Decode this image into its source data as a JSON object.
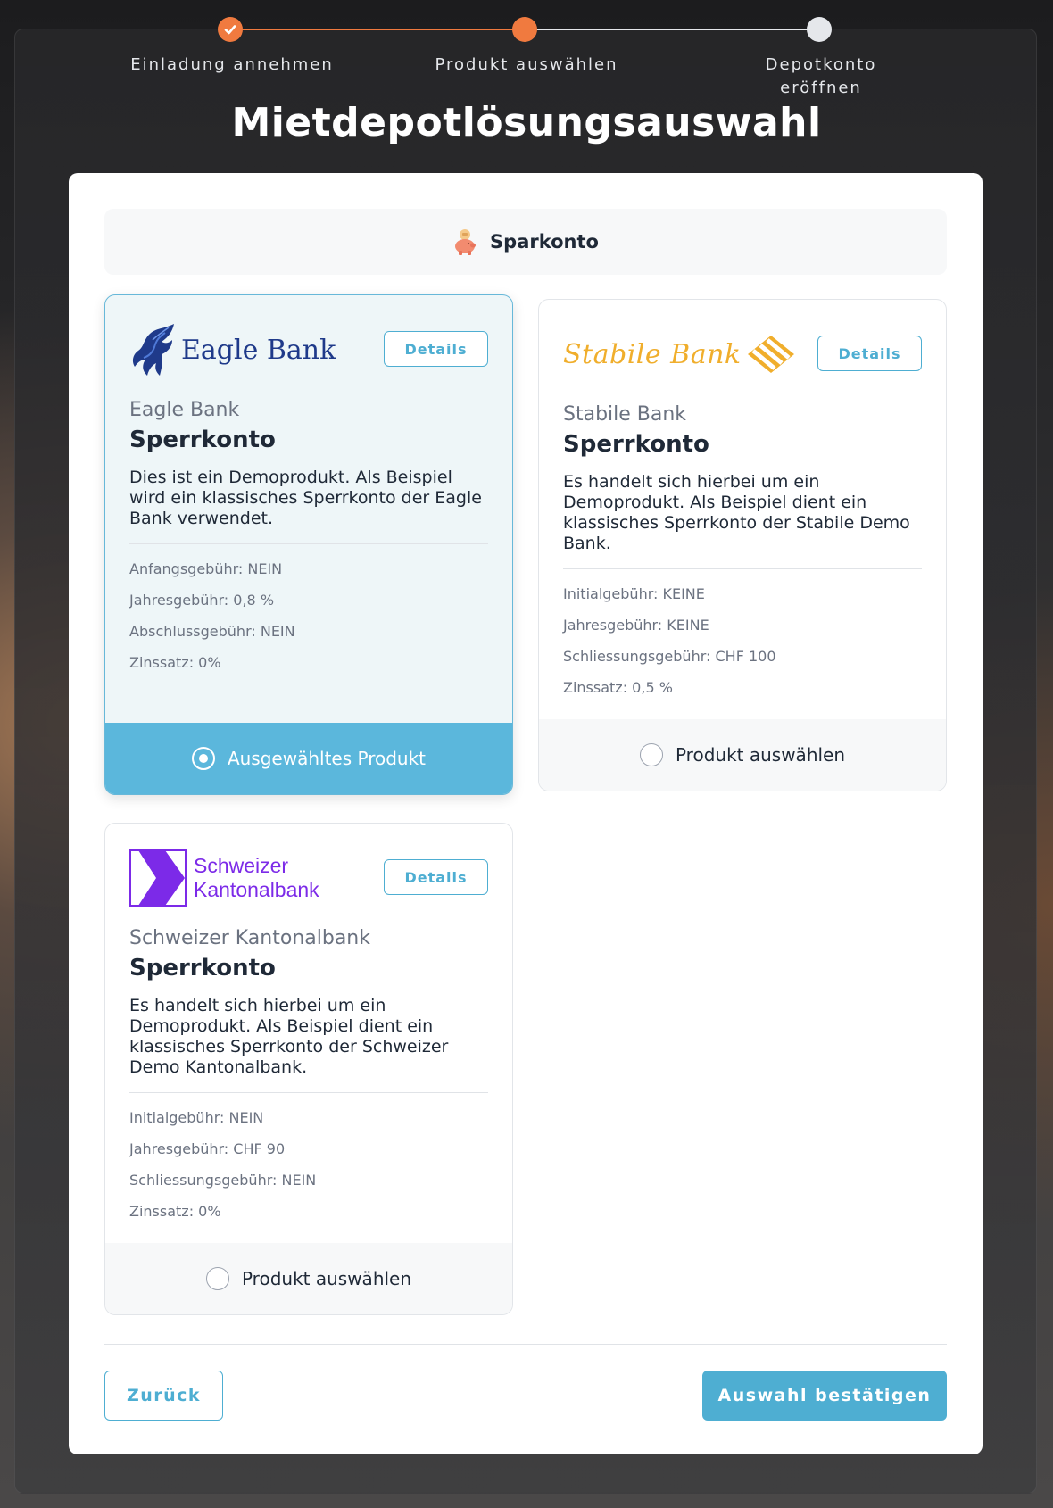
{
  "stepper": {
    "steps": [
      {
        "label": "Einladung annehmen",
        "state": "done"
      },
      {
        "label": "Produkt auswählen",
        "state": "active"
      },
      {
        "label": "Depotkonto eröffnen",
        "state": "todo"
      }
    ]
  },
  "page": {
    "title": "Mietdepotlösungsauswahl"
  },
  "category": {
    "label": "Sparkonto",
    "icon": "piggy-bank-icon"
  },
  "products": [
    {
      "logo_text": "Eagle Bank",
      "details_label": "Details",
      "bank": "Eagle Bank",
      "product": "Sperrkonto",
      "description": "Dies ist ein Demoprodukt. Als Beispiel wird ein klassisches Sperrkonto der Eagle Bank verwendet.",
      "fees": [
        "Anfangsgebühr: NEIN",
        "Jahresgebühr: 0,8 %",
        "Abschlussgebühr: NEIN",
        "Zinssatz: 0%"
      ],
      "select_label": "Ausgewähltes Produkt",
      "selected": true
    },
    {
      "logo_text": "Stabile Bank",
      "details_label": "Details",
      "bank": "Stabile Bank",
      "product": "Sperrkonto",
      "description": "Es handelt sich hierbei um ein Demoprodukt. Als Beispiel dient ein klassisches Sperrkonto der Stabile Demo Bank.",
      "fees": [
        "Initialgebühr: KEINE",
        "Jahresgebühr: KEINE",
        "Schliessungsgebühr: CHF 100",
        "Zinssatz: 0,5 %"
      ],
      "select_label": "Produkt auswählen",
      "selected": false
    },
    {
      "logo_text_line1": "Schweizer",
      "logo_text_line2": "Kantonalbank",
      "details_label": "Details",
      "bank": "Schweizer Kantonalbank",
      "product": "Sperrkonto",
      "description": "Es handelt sich hierbei um ein Demoprodukt. Als Beispiel dient ein klassisches Sperrkonto der Schweizer Demo Kantonalbank.",
      "fees": [
        "Initialgebühr: NEIN",
        "Jahresgebühr: CHF 90",
        "Schliessungsgebühr: NEIN",
        "Zinssatz: 0%"
      ],
      "select_label": "Produkt auswählen",
      "selected": false
    }
  ],
  "actions": {
    "back_label": "Zurück",
    "confirm_label": "Auswahl bestätigen"
  },
  "colors": {
    "accent": "#4eaed2",
    "step_active": "#f07a3f",
    "selected_footer": "#5bb7dc",
    "stabile_gold": "#f0ae2c",
    "kantonal_purple": "#7c2ae8",
    "eagle_navy": "#1f3a8a"
  }
}
